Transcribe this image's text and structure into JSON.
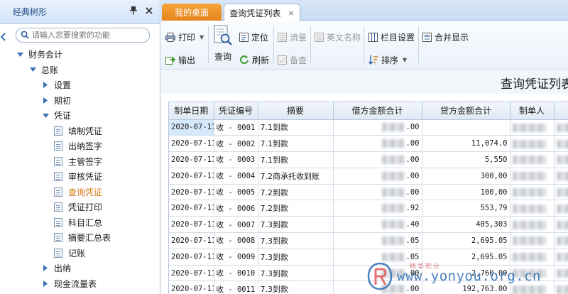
{
  "left_panel": {
    "title": "经典树形",
    "pin_icon": "pin-icon",
    "close_icon": "close-icon",
    "search": {
      "placeholder": "请输入您要搜索的功能"
    },
    "tree": [
      {
        "label": "财务会计",
        "level": 0,
        "type": "folder-open"
      },
      {
        "label": "总账",
        "level": 1,
        "type": "folder-open"
      },
      {
        "label": "设置",
        "level": 2,
        "type": "folder-closed"
      },
      {
        "label": "期初",
        "level": 2,
        "type": "folder-closed"
      },
      {
        "label": "凭证",
        "level": 2,
        "type": "folder-open"
      },
      {
        "label": "填制凭证",
        "level": 3,
        "type": "leaf"
      },
      {
        "label": "出纳签字",
        "level": 3,
        "type": "leaf"
      },
      {
        "label": "主管签字",
        "level": 3,
        "type": "leaf"
      },
      {
        "label": "审核凭证",
        "level": 3,
        "type": "leaf"
      },
      {
        "label": "查询凭证",
        "level": 3,
        "type": "leaf",
        "selected": true
      },
      {
        "label": "凭证打印",
        "level": 3,
        "type": "leaf"
      },
      {
        "label": "科目汇总",
        "level": 3,
        "type": "leaf"
      },
      {
        "label": "摘要汇总表",
        "level": 3,
        "type": "leaf"
      },
      {
        "label": "记账",
        "level": 3,
        "type": "leaf"
      },
      {
        "label": "出纳",
        "level": 2,
        "type": "folder-closed"
      },
      {
        "label": "现金流量表",
        "level": 2,
        "type": "folder-closed"
      }
    ]
  },
  "tabs": [
    {
      "label": "我的桌面",
      "active": false
    },
    {
      "label": "查询凭证列表",
      "active": true,
      "close": "×"
    }
  ],
  "toolbar": {
    "print": "打印",
    "export": "输出",
    "query": "查询",
    "locate": "定位",
    "refresh": "刷新",
    "flow": "流量",
    "check": "备查",
    "english_name": "英文名称",
    "column_settings": "栏目设置",
    "sort": "排序",
    "merge_display": "合并显示"
  },
  "page_title": "查询凭证列表",
  "table": {
    "columns": [
      "制单日期",
      "凭证编号",
      "摘要",
      "借方金额合计",
      "贷方金额合计",
      "制单人",
      "审"
    ],
    "rows": [
      {
        "date": "2020-07-11",
        "no": "收 - 0001",
        "summary": "7.1到款",
        "debit": ".00",
        "credit": "",
        "selected": true
      },
      {
        "date": "2020-07-11",
        "no": "收 - 0002",
        "summary": "7.1到款",
        "debit": ".00",
        "credit": "11,074.0"
      },
      {
        "date": "2020-07-11",
        "no": "收 - 0003",
        "summary": "7.1到款",
        "debit": ".00",
        "credit": "5,550"
      },
      {
        "date": "2020-07-11",
        "no": "收 - 0004",
        "summary": "7.2商承托收到账",
        "debit": ".00",
        "credit": "300,00"
      },
      {
        "date": "2020-07-11",
        "no": "收 - 0005",
        "summary": "7.2到款",
        "debit": ".00",
        "credit": "100,00"
      },
      {
        "date": "2020-07-11",
        "no": "收 - 0006",
        "summary": "7.2到款",
        "debit": ".92",
        "credit": "553,79"
      },
      {
        "date": "2020-07-11",
        "no": "收 - 0007",
        "summary": "7.3到款",
        "debit": ".40",
        "credit": "405,303"
      },
      {
        "date": "2020-07-11",
        "no": "收 - 0008",
        "summary": "7.3到款",
        "debit": ".05",
        "credit": "2,695.05"
      },
      {
        "date": "2020-07-11",
        "no": "收 - 0009",
        "summary": "7.3到款",
        "debit": ".05",
        "credit": "2,695.05"
      },
      {
        "date": "2020-07-11",
        "no": "收 - 0010",
        "summary": "7.3到款",
        "debit": ".00",
        "credit": "2,760.00"
      },
      {
        "date": "2020-07-11",
        "no": "收 - 0011",
        "summary": "7.3到款",
        "debit": ".00",
        "credit": "192,763.00"
      }
    ]
  },
  "watermark": {
    "text": "www.yonyou.org.cn",
    "sub": "精华积分"
  },
  "colors": {
    "accent_orange": "#e6831b",
    "selected_tree_text": "#d37711",
    "header_blue": "#1f4b8a"
  }
}
